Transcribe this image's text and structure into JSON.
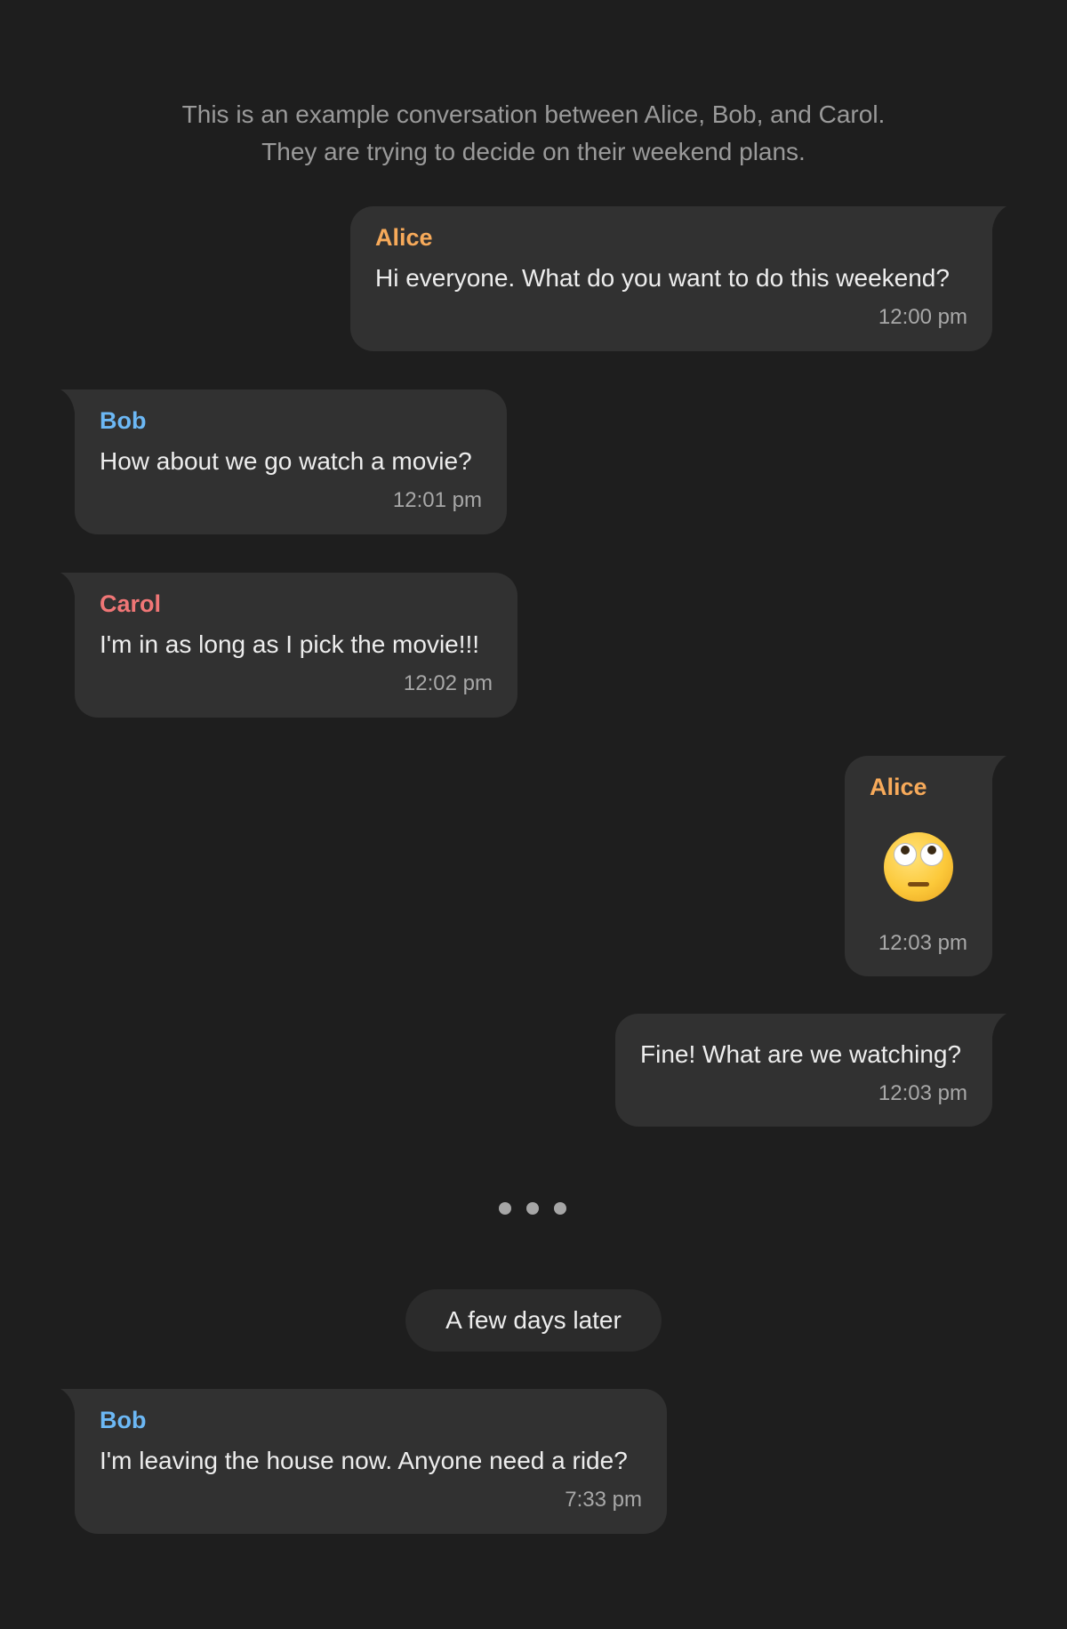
{
  "intro": {
    "line1": "This is an example conversation between Alice, Bob, and Carol.",
    "line2": "They are trying to decide on their weekend plans."
  },
  "messages": [
    {
      "sender": "Alice",
      "text": "Hi everyone. What do you want to do this weekend?",
      "time": "12:00 pm"
    },
    {
      "sender": "Bob",
      "text": "How about we go watch a movie?",
      "time": "12:01 pm"
    },
    {
      "sender": "Carol",
      "text": "I'm in as long as I pick the movie!!!",
      "time": "12:02 pm"
    },
    {
      "sender": "Alice",
      "emoji": "face-with-rolling-eyes",
      "time": "12:03 pm"
    },
    {
      "text": "Fine! What are we watching?",
      "time": "12:03 pm"
    },
    {
      "sender": "Bob",
      "text": "I'm leaving the house now. Anyone need a ride?",
      "time": "7:33 pm"
    }
  ],
  "divider": {
    "label": "A few days later"
  },
  "colors": {
    "alice": "#f7aa5a",
    "bob": "#6cb8f5",
    "carol": "#f07676",
    "bubble": "#313131",
    "background": "#1e1e1e"
  }
}
